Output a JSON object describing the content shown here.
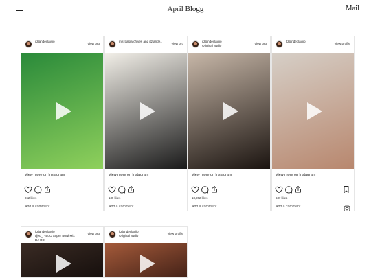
{
  "header": {
    "title": "April Blogg",
    "mail_label": "Mail",
    "menu_icon": "hamburger-icon"
  },
  "posts": [
    {
      "username": "itzlandeclavijo",
      "subtitle": "",
      "view_profile": "View pro",
      "thumb_colors": [
        "#2a8a3a",
        "#8fd05c"
      ],
      "view_more": "View more on Instagram",
      "likes": "862 likes",
      "add_comment": "Add a comment...",
      "show_bookmark": false,
      "show_ig": false
    },
    {
      "username": "mezcalparchives and itzlande..",
      "subtitle": "",
      "view_profile": "View pro",
      "thumb_colors": [
        "#f2efe8",
        "#1a1a1a"
      ],
      "view_more": "View more on Instagram",
      "likes": "139 likes",
      "add_comment": "Add a comment...",
      "show_bookmark": false,
      "show_ig": false
    },
    {
      "username": "itzlandeclavijo",
      "subtitle": "Original audio",
      "view_profile": "View pro",
      "thumb_colors": [
        "#c7b7a8",
        "#1b1410"
      ],
      "view_more": "View more on Instagram",
      "likes": "18,262 likes",
      "add_comment": "Add a comment...",
      "show_bookmark": false,
      "show_ig": false
    },
    {
      "username": "itzlandeclavijo",
      "subtitle": "",
      "view_profile": "View profile",
      "thumb_colors": [
        "#d6cfc7",
        "#b8876e"
      ],
      "view_more": "View more on Instagram",
      "likes": "637 likes",
      "add_comment": "Add a comment...",
      "show_bookmark": true,
      "show_ig": true
    },
    {
      "username": "itzlandeclavijo",
      "subtitle": "djed_ · EoO Super Bowl Mix\nDJ OD",
      "view_profile": "View pro",
      "thumb_colors": [
        "#3a2b24",
        "#120c0a"
      ],
      "view_more": "",
      "likes": "",
      "add_comment": "",
      "show_bookmark": false,
      "show_ig": false
    },
    {
      "username": "itzlandeclavijo",
      "subtitle": "Original audio",
      "view_profile": "View profile",
      "thumb_colors": [
        "#a45a3a",
        "#3a1c14"
      ],
      "view_more": "",
      "likes": "",
      "add_comment": "",
      "show_bookmark": false,
      "show_ig": false
    }
  ],
  "icons": {
    "like": "heart-icon",
    "comment": "comment-icon",
    "share": "share-icon",
    "bookmark": "bookmark-icon",
    "instagram": "instagram-icon",
    "play": "play-icon"
  }
}
